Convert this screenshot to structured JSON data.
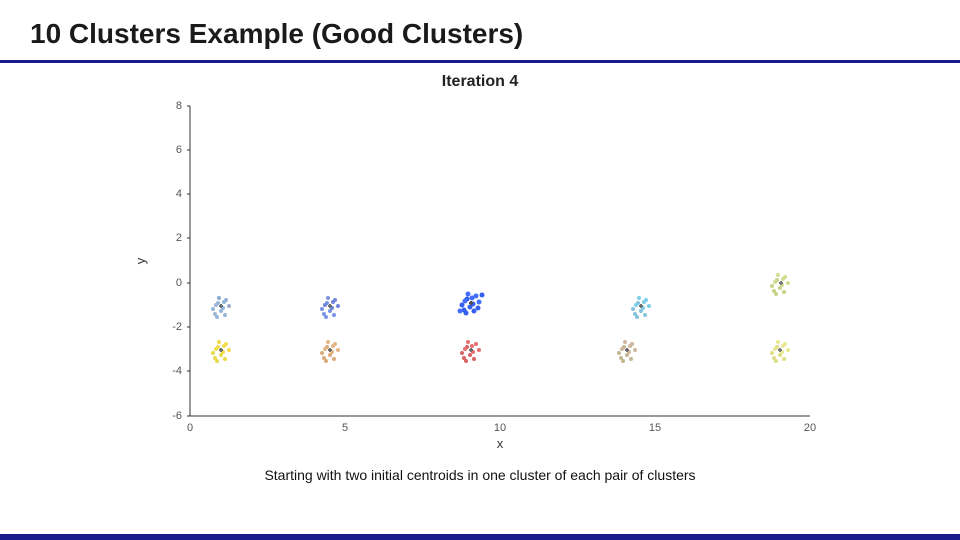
{
  "slide": {
    "title": "10 Clusters Example (Good Clusters)",
    "chart_title": "Iteration 4",
    "caption": "Starting with two initial centroids in one cluster of each pair of clusters",
    "x_axis_label": "x",
    "y_axis_label": "y",
    "x_ticks": [
      "0",
      "5",
      "10",
      "15",
      "20"
    ],
    "y_ticks": [
      "8",
      "6",
      "4",
      "2",
      "0",
      "-2",
      "-4",
      "-6"
    ],
    "accent_color": "#1a1a8c"
  }
}
